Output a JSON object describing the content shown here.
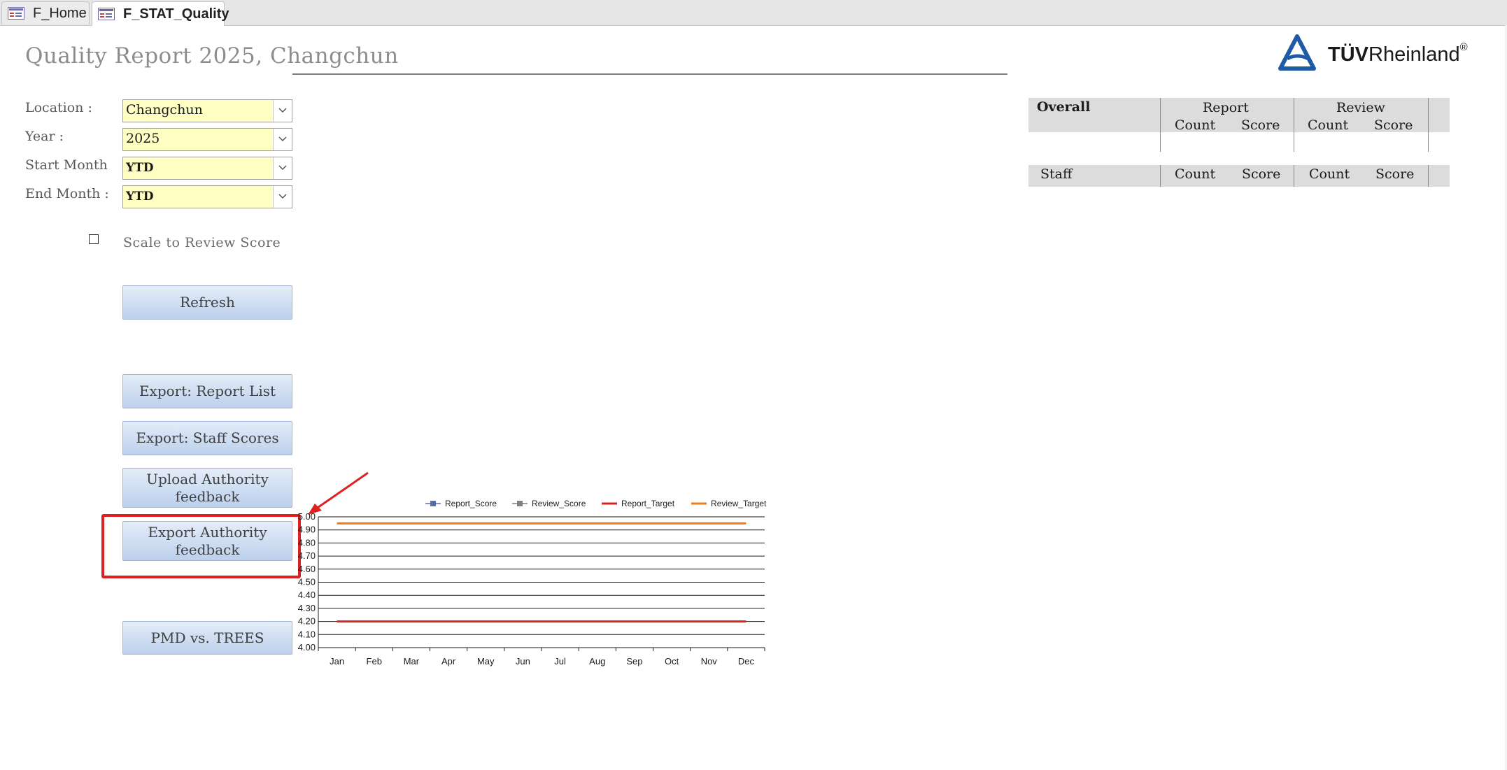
{
  "tabs": [
    {
      "label": "F_Home",
      "active": false
    },
    {
      "label": "F_STAT_Quality",
      "active": true
    }
  ],
  "title": "Quality Report 2025, Changchun",
  "logo": {
    "bold": "TÜV",
    "rest": "Rheinland",
    "mark": "®"
  },
  "filters": {
    "location": {
      "label": "Location :",
      "value": "Changchun"
    },
    "year": {
      "label": "Year :",
      "value": "2025"
    },
    "start_month": {
      "label": "Start Month",
      "value": "YTD"
    },
    "end_month": {
      "label": "End Month :",
      "value": "YTD"
    }
  },
  "scale_checkbox": {
    "label": "Scale to Review Score",
    "checked": false
  },
  "buttons": {
    "refresh": "Refresh",
    "export_report_list": "Export: Report List",
    "export_staff_scores": "Export: Staff Scores",
    "upload_authority_feedback": "Upload Authority feedback",
    "export_authority_feedback": "Export Authority feedback",
    "pmd_vs_trees": "PMD vs. TREES"
  },
  "overall_table": {
    "overall": "Overall",
    "report": "Report",
    "review": "Review",
    "count": "Count",
    "score": "Score"
  },
  "staff_table": {
    "staff": "Staff",
    "count": "Count",
    "score": "Score"
  },
  "colors": {
    "report_target": "#d9231c",
    "review_target": "#ef7d1a",
    "report_score": "#5a6fa8",
    "review_score": "#7f7f7f",
    "highlight": "#e02020"
  },
  "chart_data": {
    "type": "line",
    "categories": [
      "Jan",
      "Feb",
      "Mar",
      "Apr",
      "May",
      "Jun",
      "Jul",
      "Aug",
      "Sep",
      "Oct",
      "Nov",
      "Dec"
    ],
    "ylim": [
      4.0,
      5.0
    ],
    "yticks": [
      "4.00",
      "4.10",
      "4.20",
      "4.30",
      "4.40",
      "4.50",
      "4.60",
      "4.70",
      "4.80",
      "4.90",
      "5.00"
    ],
    "series": [
      {
        "name": "Report_Score",
        "values": []
      },
      {
        "name": "Review_Score",
        "values": []
      },
      {
        "name": "Report_Target",
        "values": [
          4.2,
          4.2,
          4.2,
          4.2,
          4.2,
          4.2,
          4.2,
          4.2,
          4.2,
          4.2,
          4.2,
          4.2
        ]
      },
      {
        "name": "Review_Target",
        "values": [
          4.95,
          4.95,
          4.95,
          4.95,
          4.95,
          4.95,
          4.95,
          4.95,
          4.95,
          4.95,
          4.95,
          4.95
        ]
      }
    ],
    "legend": "top"
  }
}
